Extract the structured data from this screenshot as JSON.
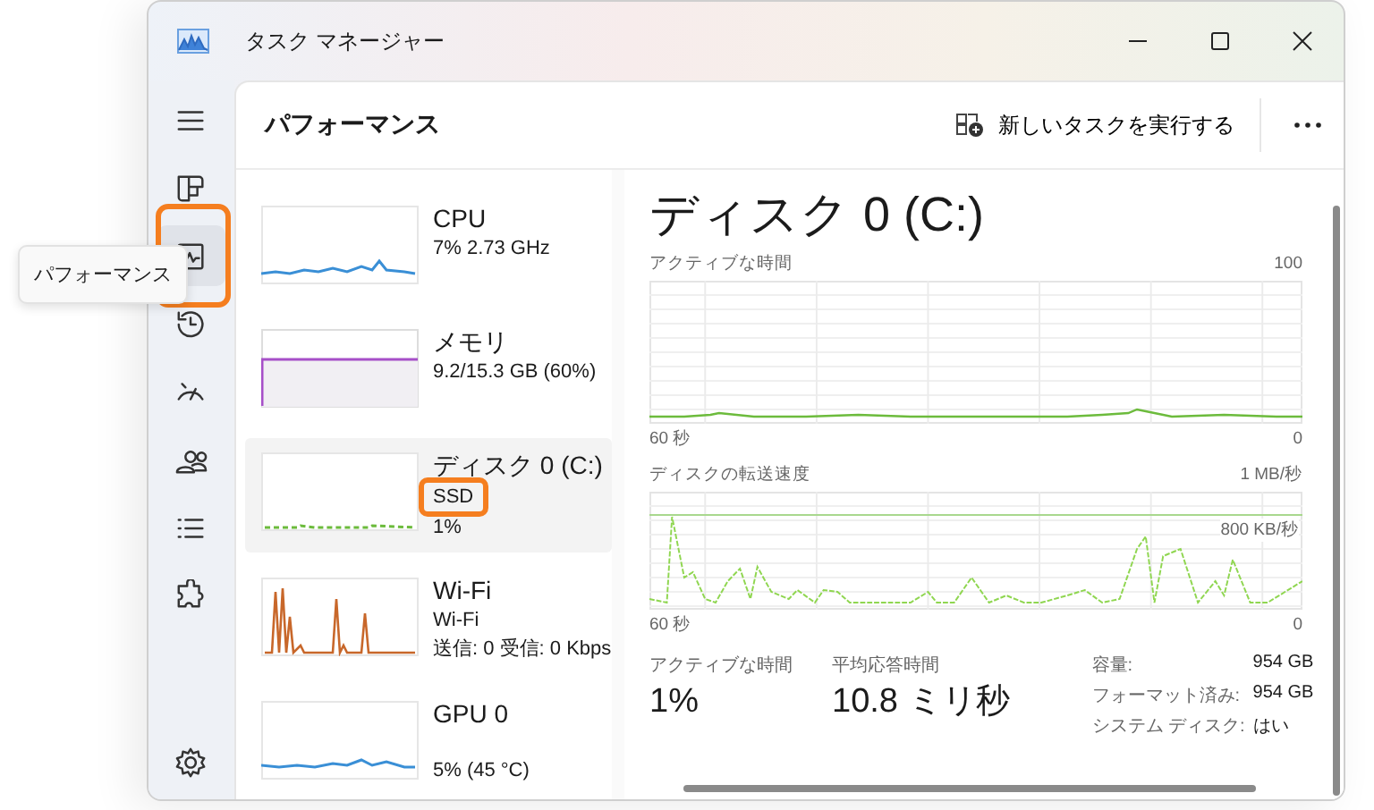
{
  "window": {
    "title": "タスク マネージャー"
  },
  "nav": [
    {
      "selected": false,
      "marked": false
    },
    {
      "selected": false,
      "marked": false
    },
    {
      "selected": true,
      "marked": true
    },
    {
      "selected": false,
      "marked": false
    },
    {
      "selected": false,
      "marked": false
    },
    {
      "selected": false,
      "marked": false
    },
    {
      "selected": false,
      "marked": false
    },
    {
      "selected": false,
      "marked": false
    },
    {
      "selected": false,
      "marked": false
    }
  ],
  "tooltip": "パフォーマンス",
  "page": {
    "title": "パフォーマンス",
    "run_task": "新しいタスクを実行する"
  },
  "devices": [
    {
      "name": "CPU",
      "kind": "line",
      "color": "#3a8fd6",
      "selected": false,
      "lines": [
        {
          "text": "7%  2.73 GHz",
          "marked": false
        }
      ]
    },
    {
      "name": "メモリ",
      "kind": "fill",
      "color": "#a64fc8",
      "selected": false,
      "lines": [
        {
          "text": "9.2/15.3 GB (60%)",
          "marked": false
        }
      ]
    },
    {
      "name": "ディスク 0 (C:)",
      "kind": "flat",
      "color": "#6cbb3c",
      "selected": true,
      "lines": [
        {
          "text": "SSD",
          "marked": true
        },
        {
          "text": "1%",
          "marked": false
        }
      ]
    },
    {
      "name": "Wi-Fi",
      "kind": "spikes",
      "color": "#c8672a",
      "selected": false,
      "lines": [
        {
          "text": "Wi-Fi",
          "marked": false
        },
        {
          "text": "送信: 0 受信: 0 Kbps",
          "marked": false
        }
      ]
    },
    {
      "name": "GPU 0",
      "kind": "line",
      "color": "#3a8fd6",
      "selected": false,
      "footer": "5% (45 °C)"
    }
  ],
  "detail": {
    "title": "ディスク 0 (C:)",
    "graph1": {
      "label": "アクティブな時間",
      "max": "100",
      "start": "60 秒",
      "end": "0"
    },
    "graph2": {
      "label": "ディスクの転送速度",
      "max": "1 MB/秒",
      "mark": "800 KB/秒",
      "start": "60 秒",
      "end": "0"
    },
    "stats": [
      {
        "label": "アクティブな時間",
        "value": "1%"
      },
      {
        "label": "平均応答時間",
        "value": "10.8 ミリ秒"
      }
    ],
    "info": [
      {
        "label": "容量:",
        "value": "954 GB"
      },
      {
        "label": "フォーマット済み:",
        "value": "954 GB"
      },
      {
        "label": "システム ディスク:",
        "value": "はい"
      }
    ]
  }
}
